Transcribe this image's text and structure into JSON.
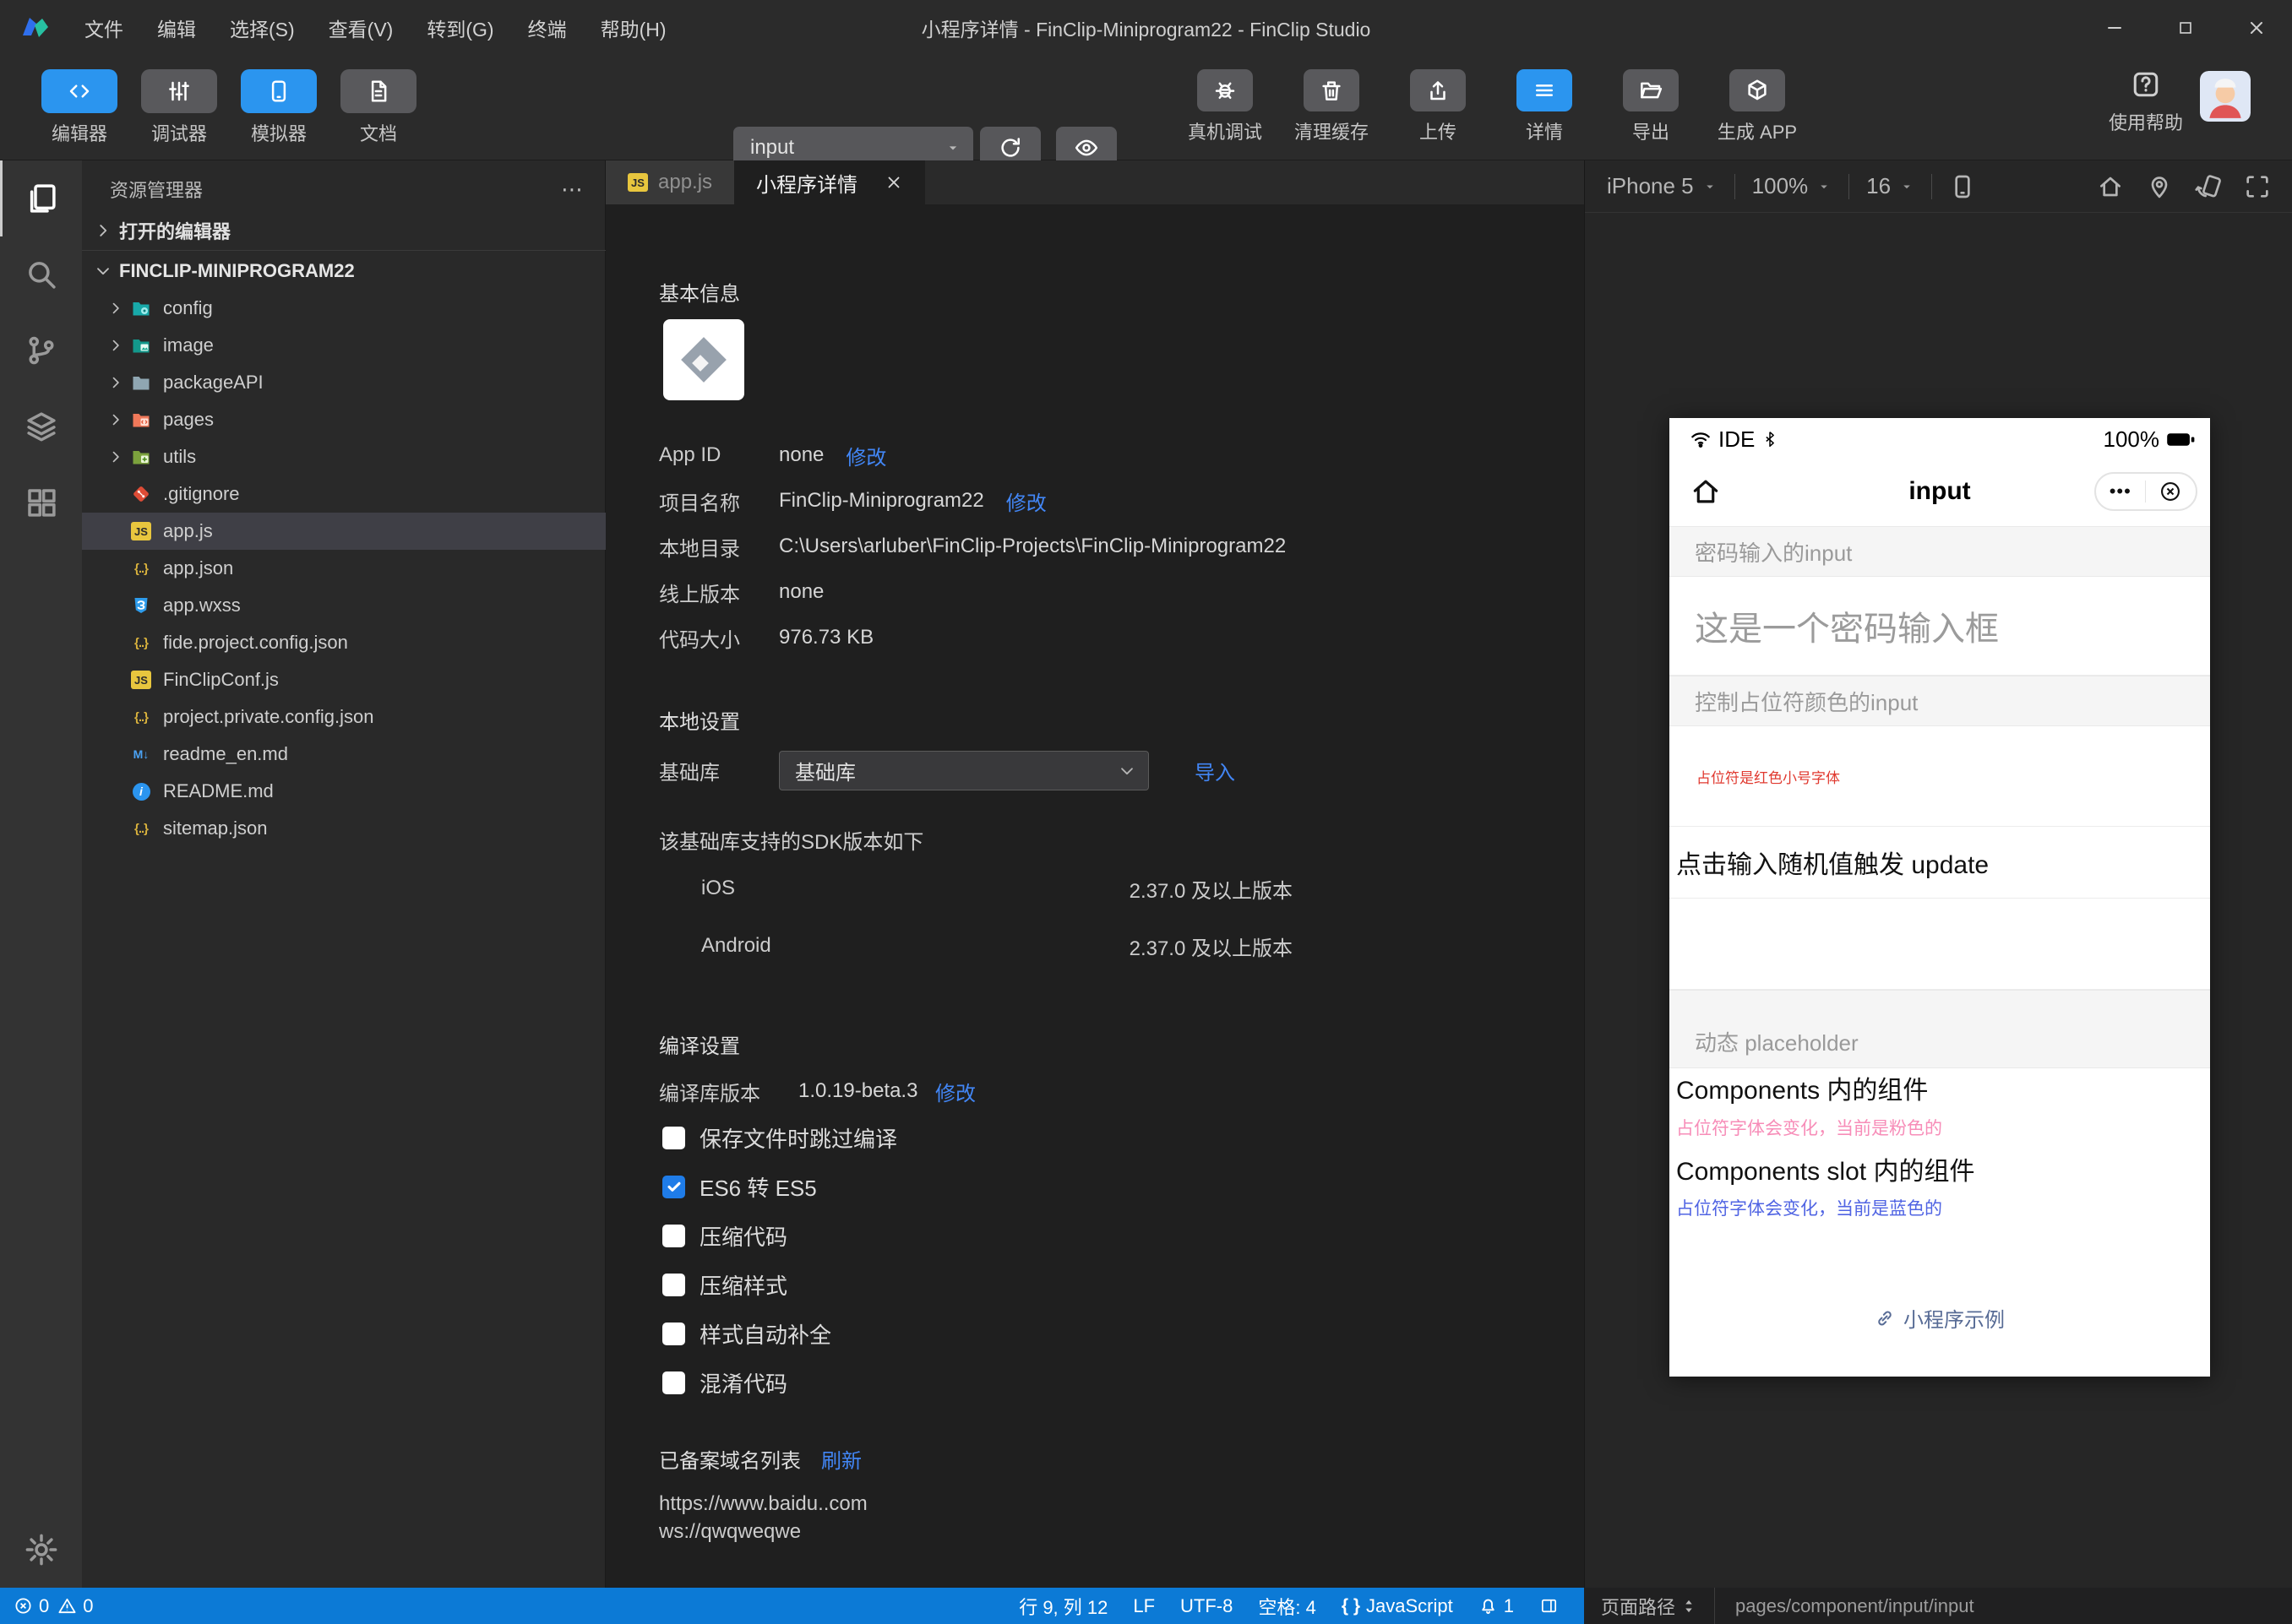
{
  "titlebar": {
    "menus": [
      "文件",
      "编辑",
      "选择(S)",
      "查看(V)",
      "转到(G)",
      "终端",
      "帮助(H)"
    ],
    "title": "小程序详情 - FinClip-Miniprogram22 - FinClip Studio"
  },
  "toolbar": {
    "modes": [
      {
        "label": "编辑器",
        "icon": "code",
        "active": true
      },
      {
        "label": "调试器",
        "icon": "sliders",
        "active": false
      },
      {
        "label": "模拟器",
        "icon": "phone",
        "active": true
      },
      {
        "label": "文档",
        "icon": "doc",
        "active": false
      }
    ],
    "page_select": {
      "value": "input"
    },
    "compile_label": "编译",
    "preview_label": "预览",
    "actions": [
      {
        "label": "真机调试",
        "icon": "bug",
        "active": false
      },
      {
        "label": "清理缓存",
        "icon": "trash",
        "active": false
      },
      {
        "label": "上传",
        "icon": "upload",
        "active": false
      },
      {
        "label": "详情",
        "icon": "menu",
        "active": true
      },
      {
        "label": "导出",
        "icon": "folder-export",
        "active": false
      },
      {
        "label": "生成 APP",
        "icon": "cube",
        "active": false
      }
    ],
    "help_label": "使用帮助"
  },
  "sidebar": {
    "title": "资源管理器",
    "open_editors": "打开的编辑器",
    "project": "FINCLIP-MINIPROGRAM22",
    "items": [
      {
        "name": "config",
        "icon": "folder-config",
        "type": "folder"
      },
      {
        "name": "image",
        "icon": "folder-image",
        "type": "folder"
      },
      {
        "name": "packageAPI",
        "icon": "folder-plain",
        "type": "folder"
      },
      {
        "name": "pages",
        "icon": "folder-pages",
        "type": "folder"
      },
      {
        "name": "utils",
        "icon": "folder-utils",
        "type": "folder"
      },
      {
        "name": ".gitignore",
        "icon": "git",
        "type": "file"
      },
      {
        "name": "app.js",
        "icon": "js",
        "type": "file",
        "selected": true
      },
      {
        "name": "app.json",
        "icon": "json",
        "type": "file"
      },
      {
        "name": "app.wxss",
        "icon": "wxss",
        "type": "file"
      },
      {
        "name": "fide.project.config.json",
        "icon": "json",
        "type": "file"
      },
      {
        "name": "FinClipConf.js",
        "icon": "js",
        "type": "file"
      },
      {
        "name": "project.private.config.json",
        "icon": "json",
        "type": "file"
      },
      {
        "name": "readme_en.md",
        "icon": "md",
        "type": "file"
      },
      {
        "name": "README.md",
        "icon": "info",
        "type": "file"
      },
      {
        "name": "sitemap.json",
        "icon": "json",
        "type": "file"
      }
    ]
  },
  "tabs": [
    {
      "label": "app.js",
      "icon": "js",
      "active": false,
      "closable": false
    },
    {
      "label": "小程序详情",
      "active": true,
      "closable": true
    }
  ],
  "detail": {
    "basic_title": "基本信息",
    "rows": [
      {
        "label": "App ID",
        "value": "none",
        "link": "修改"
      },
      {
        "label": "项目名称",
        "value": "FinClip-Miniprogram22",
        "link": "修改"
      },
      {
        "label": "本地目录",
        "value": "C:\\Users\\arluber\\FinClip-Projects\\FinClip-Miniprogram22"
      },
      {
        "label": "线上版本",
        "value": "none"
      },
      {
        "label": "代码大小",
        "value": "976.73 KB"
      }
    ],
    "local_title": "本地设置",
    "base_lib_label": "基础库",
    "base_lib_value": "基础库",
    "import_link": "导入",
    "sdk_note": "该基础库支持的SDK版本如下",
    "sdk_rows": [
      {
        "label": "iOS",
        "value": "2.37.0 及以上版本"
      },
      {
        "label": "Android",
        "value": "2.37.0 及以上版本"
      }
    ],
    "compile_title": "编译设置",
    "compile_ver_label": "编译库版本",
    "compile_ver_value": "1.0.19-beta.3",
    "compile_ver_link": "修改",
    "options": [
      {
        "label": "保存文件时跳过编译",
        "checked": false
      },
      {
        "label": "ES6 转 ES5",
        "checked": true
      },
      {
        "label": "压缩代码",
        "checked": false
      },
      {
        "label": "压缩样式",
        "checked": false
      },
      {
        "label": "样式自动补全",
        "checked": false
      },
      {
        "label": "混淆代码",
        "checked": false
      }
    ],
    "domains_title": "已备案域名列表",
    "refresh_link": "刷新",
    "domains": [
      "https://www.baidu..com",
      "ws://qwqweqwe"
    ]
  },
  "simulator": {
    "device": "iPhone 5",
    "zoom": "100%",
    "font_size": "16",
    "preview": {
      "carrier": "IDE",
      "battery": "100%",
      "nav_title": "input",
      "band1": "密码输入的input",
      "pwd_placeholder": "这是一个密码输入框",
      "band2": "控制占位符颜色的input",
      "red_placeholder": "占位符是红色小号字体",
      "update_label": "点击输入随机值触发 update",
      "band3": "动态 placeholder",
      "comp_label": "Components 内的组件",
      "pink_placeholder": "占位符字体会变化，当前是粉色的",
      "slot_label": "Components slot 内的组件",
      "blue_placeholder": "占位符字体会变化，当前是蓝色的",
      "footer_link": "小程序示例"
    }
  },
  "statusbar": {
    "errors": "0",
    "warnings": "0",
    "cursor": "行 9, 列 12",
    "eol": "LF",
    "encoding": "UTF-8",
    "indent": "空格: 4",
    "language": "JavaScript",
    "notifications": "1",
    "path_label": "页面路径",
    "page_path": "pages/component/input/input"
  },
  "colors": {
    "accent": "#2b95ef",
    "link": "#4286f5",
    "statusbar": "#0c7ad6",
    "checkbox_checked": "#1f7ce8",
    "red_text": "#e0392f",
    "pink_text": "#f78db8",
    "blue_text": "#5064e3",
    "weapp_link": "#576b95"
  }
}
